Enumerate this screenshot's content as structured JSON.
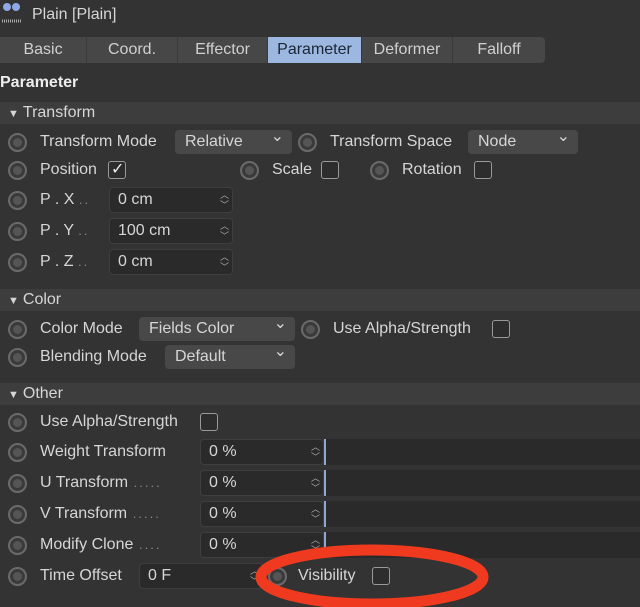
{
  "header": {
    "title": "Plain [Plain]",
    "icon": "plain-effector-icon"
  },
  "tabs": [
    {
      "label": "Basic"
    },
    {
      "label": "Coord."
    },
    {
      "label": "Effector"
    },
    {
      "label": "Parameter",
      "selected": true
    },
    {
      "label": "Deformer"
    },
    {
      "label": "Falloff"
    }
  ],
  "page_title": "Parameter",
  "transform": {
    "heading": "Transform",
    "mode_label": "Transform Mode",
    "mode_value": "Relative",
    "space_label": "Transform Space",
    "space_value": "Node",
    "position_label": "Position",
    "position_checked": true,
    "scale_label": "Scale",
    "scale_checked": false,
    "rotation_label": "Rotation",
    "rotation_checked": false,
    "px_label": "P . X",
    "px": "0 cm",
    "py_label": "P . Y",
    "py": "100 cm",
    "pz_label": "P . Z",
    "pz": "0 cm"
  },
  "color": {
    "heading": "Color",
    "mode_label": "Color Mode",
    "mode_value": "Fields Color",
    "alpha_label": "Use Alpha/Strength",
    "alpha_checked": false,
    "blend_label": "Blending Mode",
    "blend_value": "Default"
  },
  "other": {
    "heading": "Other",
    "alpha_label": "Use Alpha/Strength",
    "alpha_checked": false,
    "weight_label": "Weight Transform",
    "weight": "0 %",
    "u_label": "U Transform",
    "u": "0 %",
    "v_label": "V Transform",
    "v": "0 %",
    "clone_label": "Modify Clone",
    "clone": "0 %",
    "time_label": "Time Offset",
    "time": "0 F",
    "visibility_label": "Visibility",
    "visibility_checked": false
  },
  "annotation": {
    "color": "#f03a1f",
    "shape": "ellipse"
  },
  "colors": {
    "selected_tab": "#9db8e0",
    "background": "#333333"
  }
}
